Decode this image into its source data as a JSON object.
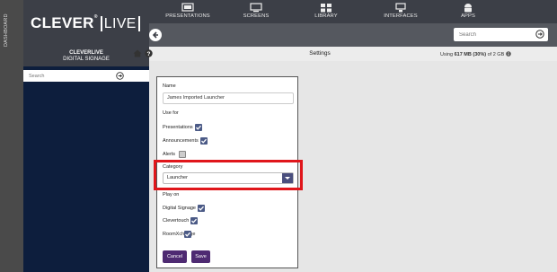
{
  "dashboard": {
    "label": "DASHBOARD"
  },
  "logo": {
    "brand": "CLEVER",
    "trademark": "®",
    "product": "LIVE"
  },
  "nav": {
    "items": [
      {
        "label": "PRESENTATIONS",
        "icon": "presentation-icon"
      },
      {
        "label": "SCREENS",
        "icon": "monitor-icon"
      },
      {
        "label": "LIBRARY",
        "icon": "library-icon"
      },
      {
        "label": "INTERFACES",
        "icon": "interfaces-icon"
      },
      {
        "label": "APPS",
        "icon": "android-icon"
      }
    ]
  },
  "search": {
    "placeholder": "Search"
  },
  "sidebar": {
    "title": "CLEVERLIVE",
    "subtitle": "DIGITAL SIGNAGE",
    "search_placeholder": "Search"
  },
  "header": {
    "title": "Settings",
    "usage_prefix": "Using ",
    "usage_value": "617 MB (30%)",
    "usage_suffix": " of 2 GB"
  },
  "form": {
    "name_label": "Name",
    "name_value": "James Imported Launcher",
    "use_for_label": "Use for",
    "use_for": [
      {
        "label": "Presentations",
        "checked": true
      },
      {
        "label": "Announcements",
        "checked": true
      },
      {
        "label": "Alerts",
        "checked": false
      }
    ],
    "category_label": "Category",
    "category_value": "Launcher",
    "play_on_label": "Play on",
    "play_on": [
      {
        "label": "Digital Signage",
        "checked": true
      },
      {
        "label": "Clevertouch",
        "checked": true
      },
      {
        "label": "RoomXchange",
        "checked": true
      }
    ],
    "cancel_label": "Cancel",
    "save_label": "Save"
  },
  "colors": {
    "highlight": "#e0161b",
    "button": "#4e2a72",
    "checkbox": "#4b5a86",
    "sidebar": "#0d1e3d",
    "topbar": "#3c3f47"
  }
}
